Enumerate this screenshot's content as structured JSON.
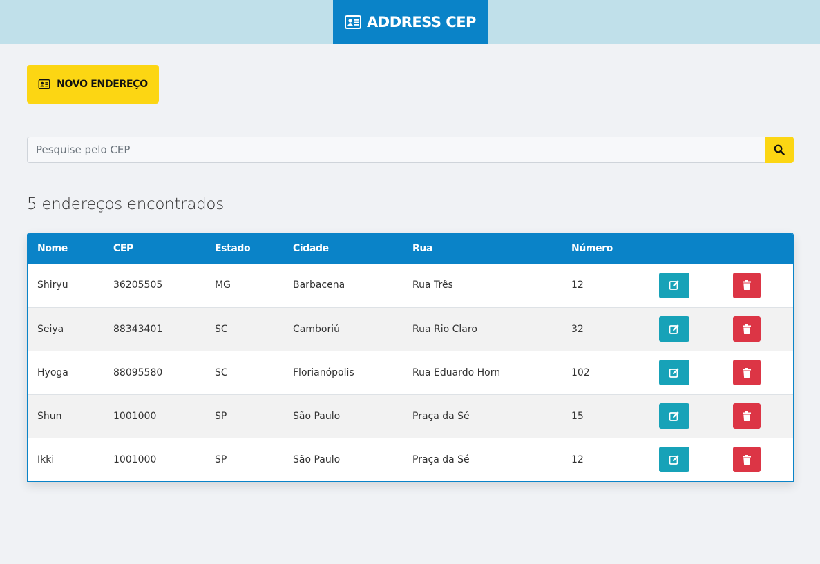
{
  "header": {
    "title": "ADDRESS CEP",
    "brand_icon": "address-card-icon"
  },
  "actions": {
    "new_address_label": "NOVO ENDEREÇO",
    "new_address_icon": "address-card-icon"
  },
  "search": {
    "placeholder": "Pesquise pelo CEP",
    "value": "",
    "button_icon": "search-icon"
  },
  "results": {
    "count_text": "5 endereços encontrados"
  },
  "table": {
    "columns": [
      "Nome",
      "CEP",
      "Estado",
      "Cidade",
      "Rua",
      "Número"
    ],
    "rows": [
      [
        "Shiryu",
        "36205505",
        "MG",
        "Barbacena",
        "Rua Três",
        "12"
      ],
      [
        "Seiya",
        "88343401",
        "SC",
        "Camboriú",
        "Rua Rio Claro",
        "32"
      ],
      [
        "Hyoga",
        "88095580",
        "SC",
        "Florianópolis",
        "Rua Eduardo Horn",
        "102"
      ],
      [
        "Shun",
        "1001000",
        "SP",
        "São Paulo",
        "Praça da Sé",
        "15"
      ],
      [
        "Ikki",
        "1001000",
        "SP",
        "São Paulo",
        "Praça da Sé",
        "12"
      ]
    ],
    "row_actions": {
      "edit_icon": "edit-icon",
      "delete_icon": "trash-icon"
    }
  },
  "colors": {
    "primary": "#0a83c8",
    "header_bg": "#c0e0ea",
    "accent_yellow": "#fcd613",
    "edit": "#17a2b8",
    "delete": "#dc3545",
    "page_bg": "#f0f2f5"
  }
}
